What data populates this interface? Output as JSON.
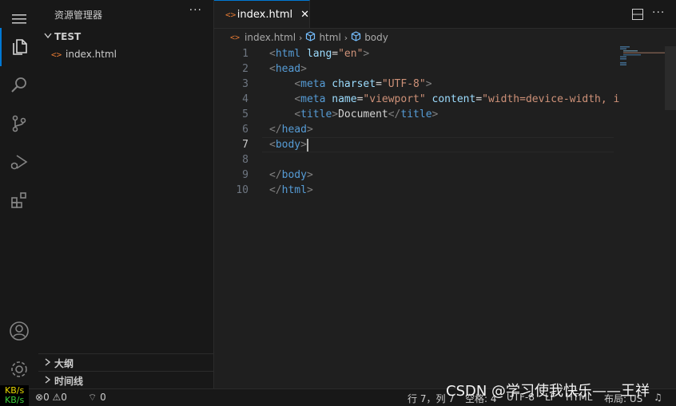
{
  "activity_bar": {
    "items": [
      {
        "name": "menu-icon"
      },
      {
        "name": "explorer-icon",
        "active": true
      },
      {
        "name": "search-icon"
      },
      {
        "name": "source-control-icon"
      },
      {
        "name": "run-debug-icon"
      },
      {
        "name": "extensions-icon"
      },
      {
        "name": "accounts-icon"
      },
      {
        "name": "manage-gear-icon"
      }
    ]
  },
  "sidebar": {
    "title": "资源管理器",
    "more": "···",
    "folder": "TEST",
    "files": [
      "index.html"
    ],
    "bottom_sections": [
      "大纲",
      "时间线"
    ]
  },
  "tabs": [
    {
      "label": "index.html",
      "close": "✕"
    }
  ],
  "breadcrumb": [
    "index.html",
    "html",
    "body"
  ],
  "editor": {
    "line_numbers": [
      "1",
      "2",
      "3",
      "4",
      "5",
      "6",
      "7",
      "8",
      "9",
      "10"
    ],
    "current_line": "7"
  },
  "status_bar": {
    "kb_top": "KB/s",
    "kb_bottom": "KB/s",
    "errors": "0",
    "warnings": "0",
    "ports": "0",
    "position": "行 7，列 7",
    "spaces": "空格: 4",
    "encoding": "UTF-8",
    "eol": "LF",
    "language": "HTML",
    "layout": "布局: US"
  },
  "watermark": "CSDN @学习使我快乐——王祥",
  "colors": {
    "accent": "#0078d4",
    "tag": "#569cd6",
    "attr": "#9cdcfe",
    "string": "#ce9178",
    "html_icon": "#e37933"
  }
}
